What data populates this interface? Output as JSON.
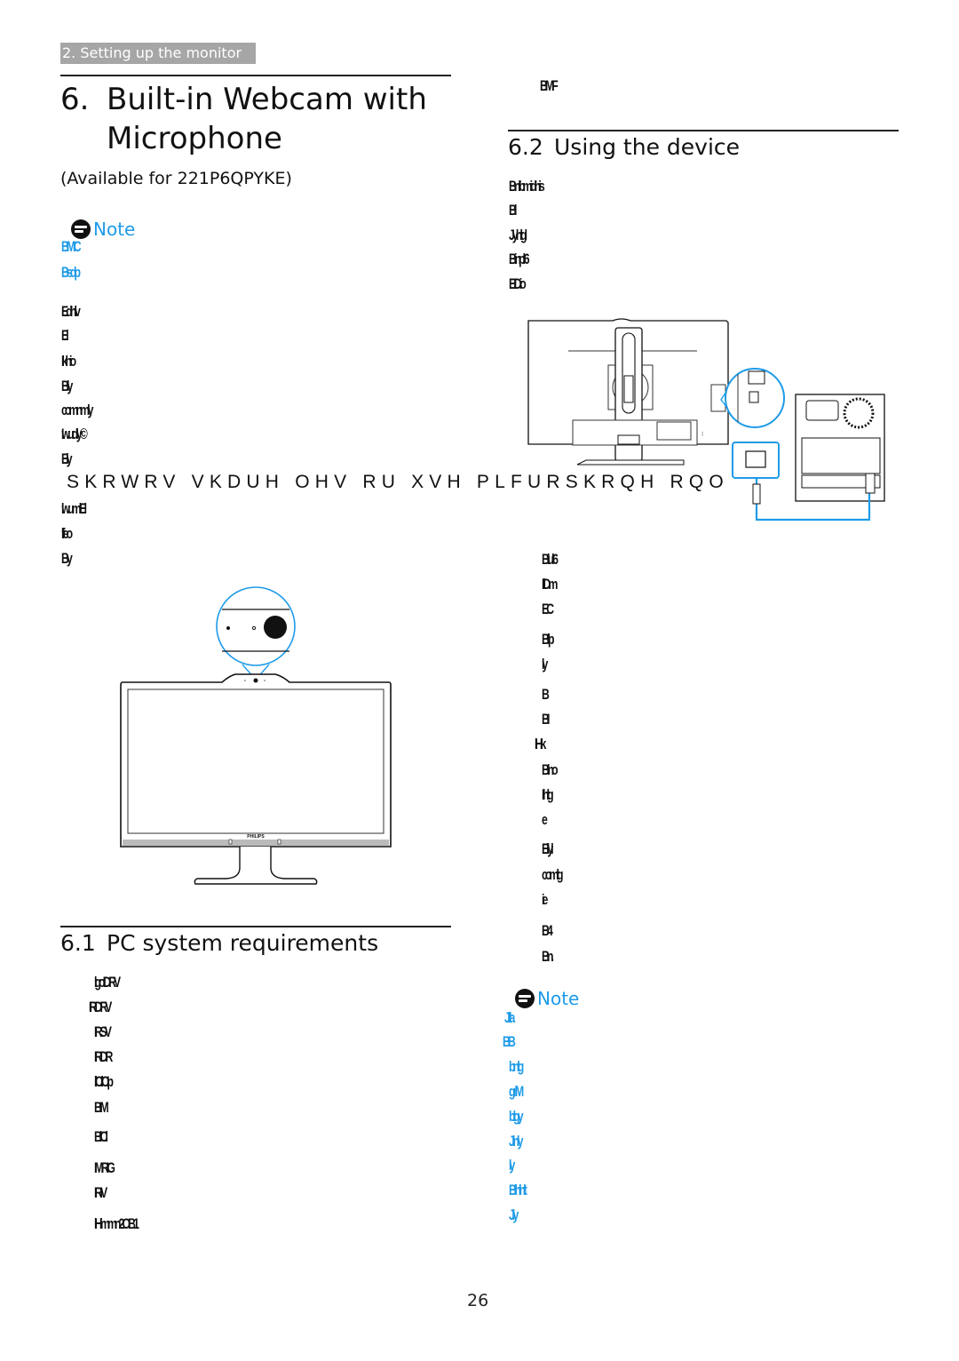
{
  "header": {
    "breadcrumb": "2. Setting up the monitor"
  },
  "title": {
    "number": "6.",
    "line1": "Built-in Webcam with",
    "line2": "Microphone"
  },
  "availability": "(Available for 221P6QPYKE)",
  "note_top": {
    "label": "Note",
    "icon": "note-icon",
    "lines": [
      "BMIC",
      "Bsdp"
    ]
  },
  "left_body_lines": [
    "Edhlv",
    "El",
    "Ikhio",
    "Bly",
    "comnmly",
    "Iwudly©",
    "Ely"
  ],
  "shifted_line": "SKRWRV  VKDUH  OHV RU XVH PLFURSKRQH RQO",
  "left_body_after": [
    "lwumlEl",
    "lfeo",
    "By"
  ],
  "webcam_figure": {
    "brand_label": "PHILIPS",
    "accent_color": "#1e9be8"
  },
  "section_61": {
    "number": "6.1",
    "title": "PC system requirements",
    "items": [
      "lgoIDRV",
      "IRDRV",
      "IRSV",
      "IRDR",
      "llCIlCIp",
      "BIM",
      "BlCl",
      "IMRIG",
      "IRIV",
      "lHimmn2OB1"
    ]
  },
  "right_top_line": "BMF",
  "section_62": {
    "number": "6.2",
    "title": "Using the device",
    "lines": [
      "Bnlbmidhis",
      "Bl",
      "Jyhlgl",
      "Binpl 6",
      "EIDio"
    ]
  },
  "connection_figure": {
    "accent_color": "#1e9be8"
  },
  "right_steps": [
    "Blul 6",
    "IIlDm",
    "EC",
    "Bllp",
    "ly",
    "B",
    "BI",
    "lHk",
    "Blno",
    "IIhlg",
    "e",
    "Ellyl",
    "comlg",
    "ie",
    "B4",
    "Bn."
  ],
  "note_bottom": {
    "label": "Note",
    "icon": "note-icon",
    "lines": [
      "Jllla",
      "BB",
      "bnlg",
      "grlM",
      "blgy",
      "Jlnly",
      "ly",
      "Blhlnlt",
      "Jly"
    ]
  },
  "footer": {
    "page_number": "26"
  }
}
